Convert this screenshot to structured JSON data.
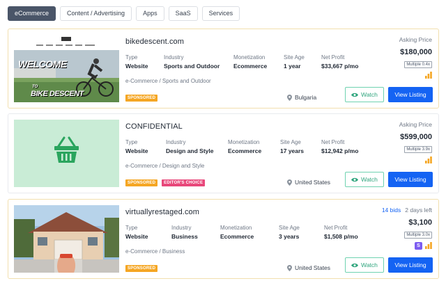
{
  "tabs": [
    {
      "label": "eCommerce",
      "active": true
    },
    {
      "label": "Content / Advertising"
    },
    {
      "label": "Apps"
    },
    {
      "label": "SaaS"
    },
    {
      "label": "Services"
    }
  ],
  "labels": {
    "type": "Type",
    "industry": "Industry",
    "monetization": "Monetization",
    "site_age": "Site Age",
    "net_profit": "Net Profit",
    "asking_price": "Asking Price",
    "watch": "Watch",
    "view_listing": "View Listing",
    "sponsored": "SPONSORED",
    "editors_choice": "EDITOR'S CHOICE"
  },
  "listings": [
    {
      "title": "bikedescent.com",
      "type": "Website",
      "industry": "Sports and Outdoor",
      "monetization": "Ecommerce",
      "site_age": "1 year",
      "net_profit": "$33,667 p/mo",
      "category": "e-Commerce / Sports and Outdoor",
      "location": "Bulgaria",
      "price": "$180,000",
      "multiple": "Multiple 0.4x",
      "thumb_text_top": "WELCOME",
      "thumb_text_bottom_small": "TO",
      "thumb_text_bottom": "BIKE DESCENT"
    },
    {
      "title": "CONFIDENTIAL",
      "type": "Website",
      "industry": "Design and Style",
      "monetization": "Ecommerce",
      "site_age": "17 years",
      "net_profit": "$12,942 p/mo",
      "category": "e-Commerce / Design and Style",
      "location": "United States",
      "price": "$599,000",
      "multiple": "Multiple 3.9x"
    },
    {
      "title": "virtuallyrestaged.com",
      "type": "Website",
      "industry": "Business",
      "monetization": "Ecommerce",
      "site_age": "3 years",
      "net_profit": "$1,508 p/mo",
      "category": "e-Commerce / Business",
      "location": "United States",
      "price": "$3,100",
      "multiple": "Multiple 3.0x",
      "bids": "14 bids",
      "time_left": "2 days left",
      "s_badge": "S"
    }
  ],
  "colors": {
    "primary": "#1463f3",
    "watch": "#2ea57d",
    "sponsored": "#f5a623",
    "editor": "#e8477a",
    "confidential_bg": "#c9ecd6",
    "basket": "#2aa55e"
  }
}
